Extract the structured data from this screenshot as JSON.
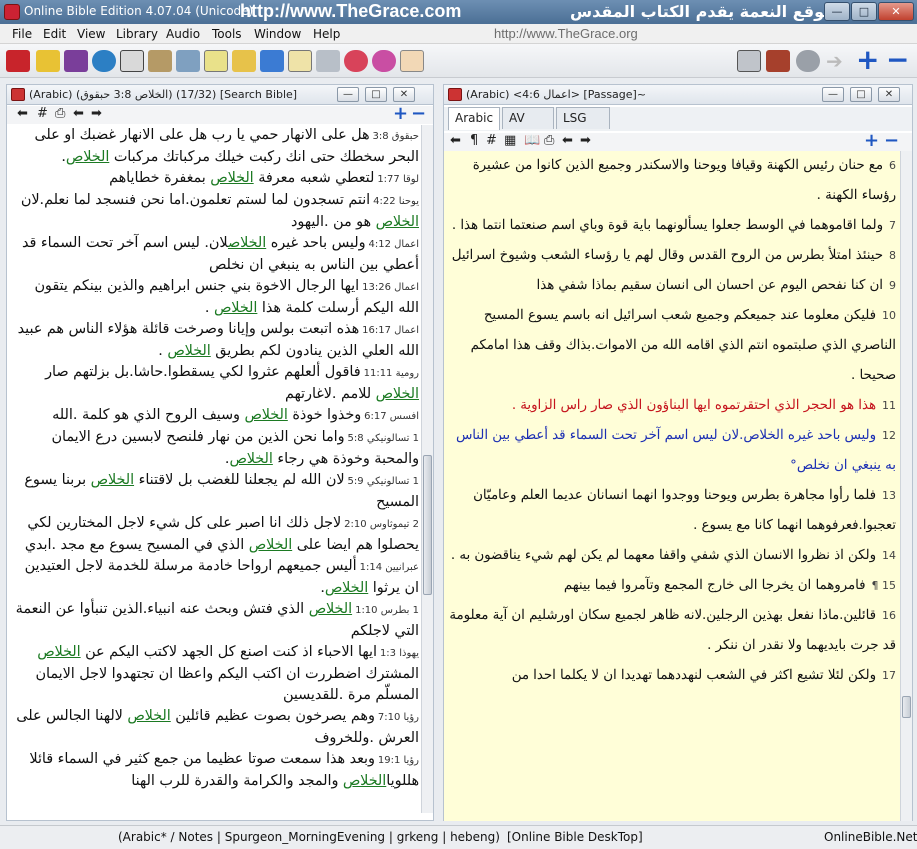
{
  "window": {
    "title": "Online Bible Edition 4.07.04  (Unicode)",
    "banner_url": "http://www.TheGrace.com",
    "banner_ar": "موقع النعمة يقدم الكتاب المقدس"
  },
  "menu": {
    "items": [
      "File",
      "Edit",
      "View",
      "Library",
      "Audio",
      "Tools",
      "Window",
      "Help"
    ],
    "url": "http://www.TheGrace.org"
  },
  "toolbar": {
    "icons": [
      "bible-icon",
      "notes-icon",
      "books-icon",
      "globe-icon",
      "open-book-icon",
      "edit-icon",
      "tools-icon",
      "clipboard-icon",
      "home-icon",
      "pen-icon",
      "document-icon",
      "printer-icon",
      "help-balloon-icon",
      "balloons-icon",
      "hand-icon"
    ],
    "right_icons": [
      "search-magnifier-icon",
      "settings-tools-icon",
      "gear-icon",
      "arrow-right-icon",
      "plus-icon",
      "minus-icon"
    ]
  },
  "left_pane": {
    "header": "(Arabic) (الخلاص 3:8 حبقوق) (17/32) [Search Bible]",
    "verses": [
      {
        "ref": "حبقوق 3:8",
        "parts": [
          [
            "هل على الانهار حمي يا رب هل على الانهار غضبك او على البحر سخطك حتى انك ركبت خيلك مركباتك مركبات ",
            0
          ],
          [
            "الخلاص",
            1
          ],
          [
            ".",
            0
          ]
        ]
      },
      {
        "ref": "لوقا 1:77",
        "parts": [
          [
            "لتعطي شعبه معرفة ",
            0
          ],
          [
            "الخلاص",
            1
          ],
          [
            " بمغفرة خطاياهم",
            0
          ]
        ]
      },
      {
        "ref": "يوحنا 4:22",
        "parts": [
          [
            "انتم تسجدون لما لستم تعلمون.اما نحن فنسجد لما نعلم.لان ",
            0
          ],
          [
            "الخلاص",
            1
          ],
          [
            " هو من .اليهود",
            0
          ]
        ]
      },
      {
        "ref": "اعمال 4:12",
        "parts": [
          [
            "وليس باحد غيره ",
            0
          ],
          [
            "الخلاص",
            1
          ],
          [
            "لان. ليس اسم آخر تحت السماء قد أعطي بين الناس به ينبغي ان نخلص",
            0
          ]
        ]
      },
      {
        "ref": "اعمال 13:26",
        "parts": [
          [
            "ايها الرجال الاخوة بني جنس ابراهيم والذين بينكم يتقون الله اليكم أرسلت كلمة هذا ",
            0
          ],
          [
            "الخلاص",
            1
          ],
          [
            " .",
            0
          ]
        ]
      },
      {
        "ref": "اعمال 16:17",
        "parts": [
          [
            "هذه اتبعت بولس وإيانا وصرخت قائلة هؤلاء الناس هم عبيد الله العلي الذين ينادون لكم بطريق ",
            0
          ],
          [
            "الخلاص",
            1
          ],
          [
            " .",
            0
          ]
        ]
      },
      {
        "ref": "رومية 11:11",
        "parts": [
          [
            "فاقول ألعلهم عثروا لكي يسقطوا.حاشا.بل بزلتهم صار ",
            0
          ],
          [
            "الخلاص",
            1
          ],
          [
            " للامم .لاغارتهم",
            0
          ]
        ]
      },
      {
        "ref": "افسس 6:17",
        "parts": [
          [
            "وخذوا خوذة ",
            0
          ],
          [
            "الخلاص",
            1
          ],
          [
            " وسيف الروح الذي هو كلمة .الله",
            0
          ]
        ]
      },
      {
        "ref": "1 تسالونيكي 5:8",
        "parts": [
          [
            "واما نحن الذين من نهار فلنصح لابسين درع الايمان والمحبة وخوذة هي رجاء ",
            0
          ],
          [
            "الخلاص",
            1
          ],
          [
            ".",
            0
          ]
        ]
      },
      {
        "ref": "1 تسالونيكي 5:9",
        "parts": [
          [
            "لان الله لم يجعلنا للغضب بل لاقتناء ",
            0
          ],
          [
            "الخلاص",
            1
          ],
          [
            " بربنا يسوع المسيح",
            0
          ]
        ]
      },
      {
        "ref": "2 تيموثاوس 2:10",
        "parts": [
          [
            "لاجل ذلك انا اصبر على كل شيء لاجل المختارين لكي يحصلوا هم ايضا على ",
            0
          ],
          [
            "الخلاص",
            1
          ],
          [
            " الذي في المسيح يسوع مع مجد .ابدي",
            0
          ]
        ]
      },
      {
        "ref": "عبرانيين 1:14",
        "parts": [
          [
            "أليس جميعهم ارواحا خادمة مرسلة للخدمة لاجل العتيدين ان يرثوا ",
            0
          ],
          [
            "الخلاص",
            1
          ],
          [
            ".",
            0
          ]
        ]
      },
      {
        "ref": "1 بطرس 1:10",
        "parts": [
          [
            "",
            0
          ],
          [
            "الخلاص",
            1
          ],
          [
            " الذي فتش وبحث عنه انبياء.الذين تنبأوا عن النعمة التي لاجلكم",
            0
          ]
        ]
      },
      {
        "ref": "يهوذا 1:3",
        "parts": [
          [
            "ايها الاحباء اذ كنت اصنع كل الجهد لاكتب اليكم عن ",
            0
          ],
          [
            "الخلاص",
            1
          ],
          [
            " المشترك اضطررت ان اكتب اليكم واعظا ان تجتهدوا لاجل الايمان المسلّم مرة .للقديسين",
            0
          ]
        ]
      },
      {
        "ref": "رؤيا 7:10",
        "parts": [
          [
            "وهم يصرخون بصوت عظيم قائلين ",
            0
          ],
          [
            "الخلاص",
            1
          ],
          [
            " لالهنا الجالس على العرش .وللخروف",
            0
          ]
        ]
      },
      {
        "ref": "رؤيا 19:1",
        "parts": [
          [
            "وبعد هذا سمعت صوتا عظيما من جمع كثير في السماء قائلا هللويا",
            0
          ],
          [
            "الخلاص",
            1
          ],
          [
            " والمجد والكرامة والقدرة للرب الهنا",
            0
          ]
        ]
      }
    ]
  },
  "right_pane": {
    "header": "(Arabic) <اعمال 4:6> [Passage]~",
    "tabs": [
      "Arabic",
      "AV",
      "LSG"
    ],
    "verses": [
      {
        "n": "6",
        "text": "مع حنان رئيس الكهنة وقيافا ويوحنا والاسكندر وجميع الذين كانوا من عشيرة رؤساء الكهنة .",
        "style": "normal"
      },
      {
        "n": "7",
        "text": "ولما اقاموهما في الوسط جعلوا يسألونهما باية قوة وباي اسم صنعتما انتما هذا .",
        "style": "normal"
      },
      {
        "n": "8",
        "text": "حينئذ امتلأ بطرس من الروح القدس وقال لهم يا رؤساء الشعب وشيوخ اسرائيل",
        "style": "normal"
      },
      {
        "n": "9",
        "text": "ان كنا نفحص اليوم عن احسان الى انسان سقيم بماذا شفي هذا",
        "style": "normal"
      },
      {
        "n": "10",
        "text": "فليكن معلوما عند جميعكم وجميع شعب اسرائيل انه باسم يسوع المسيح الناصري الذي صلبتموه انتم الذي اقامه الله من الاموات.بذاك وقف هذا امامكم صحيحا .",
        "style": "normal"
      },
      {
        "n": "11",
        "text": "هذا هو الحجر الذي احتقرتموه ايها البناؤون الذي صار راس الزاوية .",
        "style": "red"
      },
      {
        "n": "12",
        "text": "وليس باحد غيره الخلاص.لان ليس اسم آخر تحت السماء قد أعطي بين الناس به ينبغي ان نخلص°",
        "style": "blue"
      },
      {
        "n": "13",
        "text": "فلما رأوا مجاهرة بطرس ويوحنا ووجدوا انهما انسانان عديما العلم وعاميّان تعجبوا.فعرفوهما انهما كانا مع يسوع .",
        "style": "normal"
      },
      {
        "n": "14",
        "text": "ولكن اذ نظروا الانسان الذي شفي واقفا معهما لم يكن لهم شيء يناقضون به .",
        "style": "normal"
      },
      {
        "n": "15 ¶",
        "text": "فامروهما ان يخرجا الى خارج المجمع وتآمروا فيما بينهم",
        "style": "normal"
      },
      {
        "n": "16",
        "text": "قائلين.ماذا نفعل بهذين الرجلين.لانه ظاهر لجميع سكان اورشليم ان آية معلومة قد جرت بايديهما ولا نقدر ان ننكر .",
        "style": "normal"
      },
      {
        "n": "17",
        "text": "ولكن لئلا تشيع اكثر في الشعب لنهددهما تهديدا ان لا يكلما احدا من",
        "style": "normal"
      }
    ]
  },
  "status": {
    "left": "(Arabic* / Notes | Spurgeon_MorningEvening | grkeng | hebeng)",
    "mid": "[Online Bible DeskTop]",
    "right": "OnlineBible.Net"
  }
}
